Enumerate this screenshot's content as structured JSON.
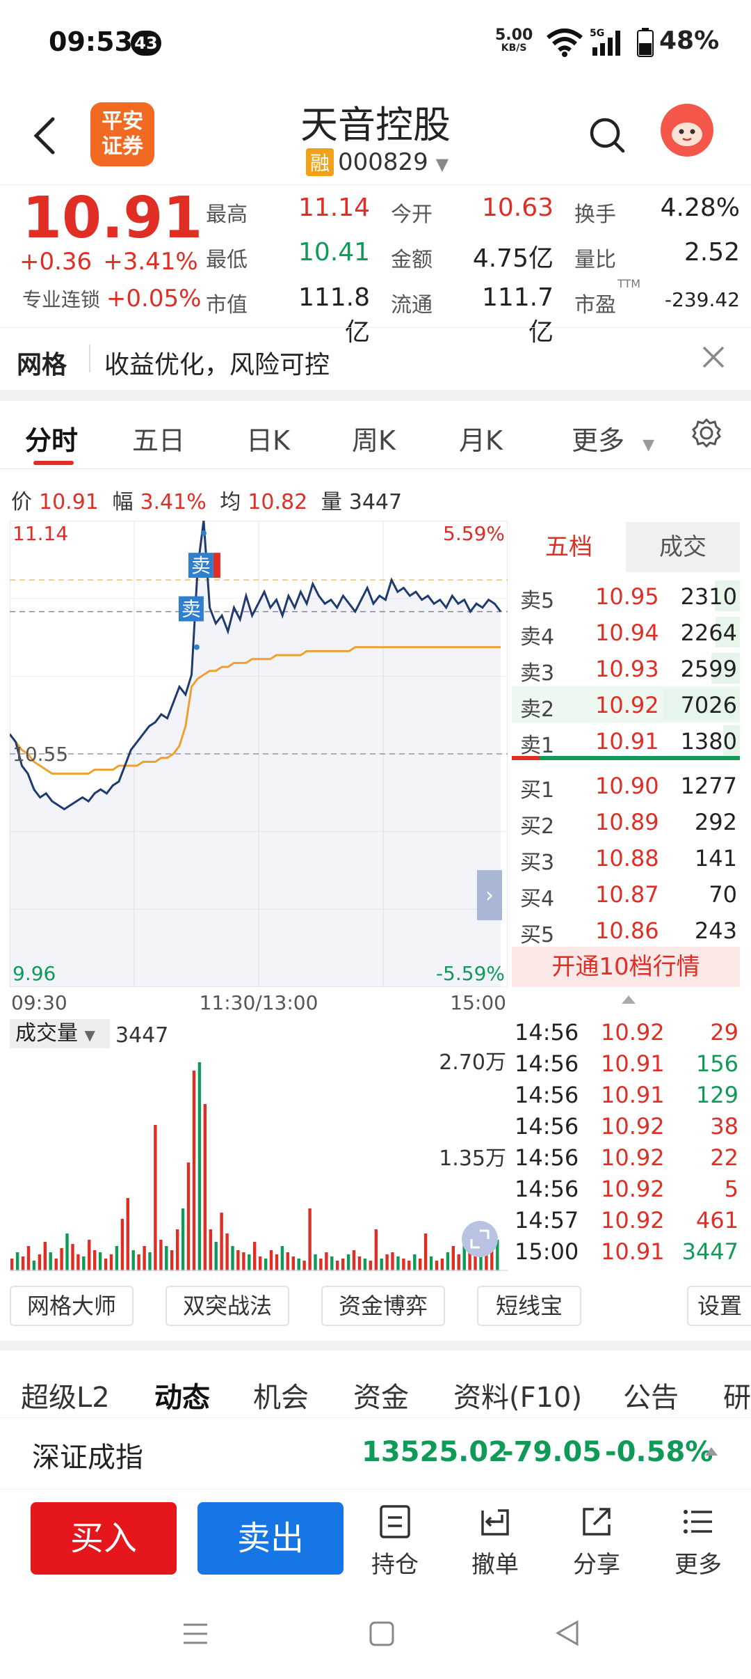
{
  "status": {
    "time": "09:53",
    "notif": "43",
    "speed": "5.00",
    "speed_unit": "KB/S",
    "battery": "48%"
  },
  "header": {
    "logo_line1": "平安",
    "logo_line2": "证券",
    "name": "天音控股",
    "rong": "融",
    "code": "000829"
  },
  "quote": {
    "price": "10.91",
    "change": "+0.36",
    "change_pct": "+3.41%",
    "prof_label": "专业连锁",
    "prof_value": "+0.05%",
    "cells": [
      {
        "label": "最高",
        "value": "11.14",
        "color": "red"
      },
      {
        "label": "今开",
        "value": "10.63",
        "color": "red"
      },
      {
        "label": "换手",
        "value": "4.28%",
        "color": "black"
      },
      {
        "label": "最低",
        "value": "10.41",
        "color": "green"
      },
      {
        "label": "金额",
        "value": "4.75亿",
        "color": "black"
      },
      {
        "label": "量比",
        "value": "2.52",
        "color": "black"
      },
      {
        "label": "市值",
        "value": "111.8亿",
        "color": "black"
      },
      {
        "label": "流通",
        "value": "111.7亿",
        "color": "black"
      },
      {
        "label": "市盈",
        "value": "-239.42",
        "color": "black"
      }
    ],
    "ttm": "TTM"
  },
  "banner": {
    "title": "网格",
    "text": "收益优化，风险可控"
  },
  "tabs": [
    "分时",
    "五日",
    "日K",
    "周K",
    "月K",
    "更多"
  ],
  "info": {
    "price_label": "价",
    "price": "10.91",
    "amp_label": "幅",
    "amp": "3.41%",
    "avg_label": "均",
    "avg": "10.82",
    "vol_label": "量",
    "vol": "3447"
  },
  "chart_data": {
    "type": "line",
    "title": "",
    "x_labels": [
      "09:30",
      "11:30/13:00",
      "15:00"
    ],
    "y_high": "11.14",
    "y_mid": "10.55",
    "y_low": "9.96",
    "pct_high": "5.59%",
    "pct_low": "-5.59%",
    "ylim": [
      9.96,
      11.14
    ],
    "prev_close": 10.55,
    "series": [
      {
        "values": [
          10.6,
          10.58,
          10.52,
          10.5,
          10.46,
          10.44,
          10.45,
          10.43,
          10.42,
          10.41,
          10.42,
          10.43,
          10.44,
          10.43,
          10.45,
          10.46,
          10.45,
          10.47,
          10.48,
          10.52,
          10.56,
          10.58,
          10.6,
          10.62,
          10.63,
          10.65,
          10.64,
          10.68,
          10.72,
          10.7,
          10.75,
          11.02,
          11.14,
          10.92,
          10.88,
          10.9,
          10.86,
          10.92,
          10.89,
          10.95,
          10.9,
          10.93,
          10.96,
          10.92,
          10.94,
          10.9,
          10.95,
          10.92,
          10.96,
          10.93,
          10.98,
          10.95,
          10.93,
          10.94,
          10.92,
          10.95,
          10.93,
          10.91,
          10.94,
          10.97,
          10.93,
          10.95,
          10.94,
          10.99,
          10.96,
          10.97,
          10.95,
          10.96,
          10.94,
          10.95,
          10.93,
          10.94,
          10.92,
          10.95,
          10.93,
          10.94,
          10.91,
          10.93,
          10.92,
          10.94,
          10.93,
          10.91
        ]
      },
      {
        "values": [
          10.6,
          10.58,
          10.56,
          10.55,
          10.53,
          10.52,
          10.51,
          10.5,
          10.5,
          10.5,
          10.5,
          10.5,
          10.5,
          10.5,
          10.51,
          10.51,
          10.51,
          10.51,
          10.52,
          10.52,
          10.52,
          10.52,
          10.53,
          10.53,
          10.53,
          10.54,
          10.54,
          10.55,
          10.57,
          10.62,
          10.72,
          10.74,
          10.75,
          10.76,
          10.76,
          10.77,
          10.77,
          10.78,
          10.78,
          10.78,
          10.79,
          10.79,
          10.79,
          10.79,
          10.8,
          10.8,
          10.8,
          10.8,
          10.8,
          10.81,
          10.81,
          10.81,
          10.81,
          10.81,
          10.81,
          10.81,
          10.81,
          10.82,
          10.82,
          10.82,
          10.82,
          10.82,
          10.82,
          10.82,
          10.82,
          10.82,
          10.82,
          10.82,
          10.82,
          10.82,
          10.82,
          10.82,
          10.82,
          10.82,
          10.82,
          10.82,
          10.82,
          10.82,
          10.82,
          10.82,
          10.82,
          10.82
        ]
      }
    ],
    "trade_marks": [
      "卖",
      "卖"
    ]
  },
  "volume": {
    "label": "成交量",
    "value": "3447",
    "max_label": "2.70万",
    "mid_label": "1.35万",
    "bars": [
      6,
      9,
      7,
      12,
      5,
      8,
      14,
      9,
      6,
      11,
      18,
      13,
      8,
      7,
      15,
      10,
      9,
      6,
      8,
      12,
      25,
      35,
      10,
      8,
      12,
      9,
      70,
      15,
      12,
      10,
      20,
      30,
      52,
      96,
      100,
      80,
      20,
      14,
      28,
      18,
      12,
      10,
      9,
      8,
      14,
      7,
      6,
      10,
      8,
      12,
      9,
      7,
      6,
      5,
      30,
      8,
      6,
      9,
      7,
      5,
      6,
      8,
      10,
      7,
      6,
      5,
      20,
      6,
      8,
      9,
      7,
      6,
      5,
      8,
      6,
      18,
      7,
      5,
      6,
      9,
      12,
      8,
      14,
      10,
      16,
      12,
      9,
      20,
      15
    ]
  },
  "book": {
    "tab_active": "五档",
    "tab_other": "成交",
    "sells": [
      {
        "label": "卖5",
        "price": "10.95",
        "vol": "2310",
        "bar": 0.33
      },
      {
        "label": "卖4",
        "price": "10.94",
        "vol": "2264",
        "bar": 0.32
      },
      {
        "label": "卖3",
        "price": "10.93",
        "vol": "2599",
        "bar": 0.37
      },
      {
        "label": "卖2",
        "price": "10.92",
        "vol": "7026",
        "bar": 1.0
      },
      {
        "label": "卖1",
        "price": "10.91",
        "vol": "1380",
        "bar": 0.2
      }
    ],
    "buys": [
      {
        "label": "买1",
        "price": "10.90",
        "vol": "1277"
      },
      {
        "label": "买2",
        "price": "10.89",
        "vol": "292"
      },
      {
        "label": "买3",
        "price": "10.88",
        "vol": "141"
      },
      {
        "label": "买4",
        "price": "10.87",
        "vol": "70"
      },
      {
        "label": "买5",
        "price": "10.86",
        "vol": "243"
      }
    ],
    "cta": "开通10档行情"
  },
  "ticks": [
    {
      "t": "14:56",
      "p": "10.92",
      "v": "29",
      "c": "red"
    },
    {
      "t": "14:56",
      "p": "10.91",
      "v": "156",
      "c": "green"
    },
    {
      "t": "14:56",
      "p": "10.91",
      "v": "129",
      "c": "green"
    },
    {
      "t": "14:56",
      "p": "10.92",
      "v": "38",
      "c": "red"
    },
    {
      "t": "14:56",
      "p": "10.92",
      "v": "22",
      "c": "red"
    },
    {
      "t": "14:56",
      "p": "10.92",
      "v": "5",
      "c": "red"
    },
    {
      "t": "14:57",
      "p": "10.92",
      "v": "461",
      "c": "red"
    },
    {
      "t": "15:00",
      "p": "10.91",
      "v": "3447",
      "c": "green"
    }
  ],
  "tools": [
    "网格大师",
    "双突战法",
    "资金博弈",
    "短线宝",
    "设置"
  ],
  "bottom_tabs": [
    "超级L2",
    "动态",
    "机会",
    "资金",
    "资料(F10)",
    "公告",
    "研"
  ],
  "index": {
    "name": "深证成指",
    "value": "13525.02",
    "change": "-79.05",
    "pct": "-0.58%"
  },
  "actions": {
    "buy": "买入",
    "sell": "卖出",
    "hold": "持仓",
    "cancel": "撤单",
    "share": "分享",
    "more": "更多"
  }
}
